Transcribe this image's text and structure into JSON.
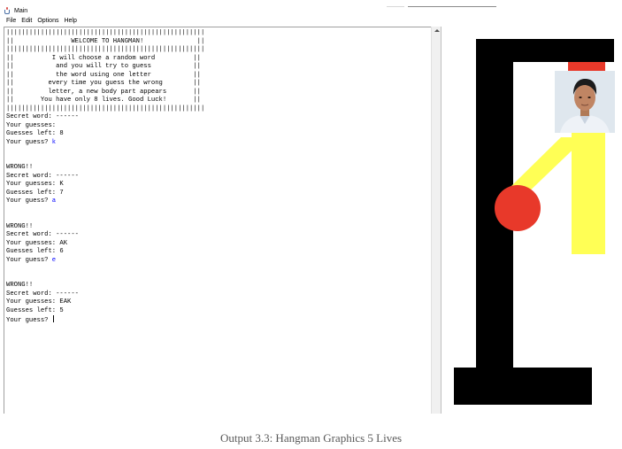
{
  "window": {
    "title": "Main"
  },
  "menu": {
    "items": [
      "File",
      "Edit",
      "Options",
      "Help"
    ]
  },
  "console": {
    "lines": [
      {
        "text": "||||||||||||||||||||||||||||||||||||||||||||||||||||"
      },
      {
        "text": "||               WELCOME TO HANGMAN!              ||"
      },
      {
        "text": "||||||||||||||||||||||||||||||||||||||||||||||||||||"
      },
      {
        "text": "||          I will choose a random word          ||"
      },
      {
        "text": "||           and you will try to guess           ||"
      },
      {
        "text": "||           the word using one letter           ||"
      },
      {
        "text": "||         every time you guess the wrong        ||"
      },
      {
        "text": "||         letter, a new body part appears       ||"
      },
      {
        "text": "||       You have only 8 lives. Good Luck!       ||"
      },
      {
        "text": "||||||||||||||||||||||||||||||||||||||||||||||||||||"
      },
      {
        "text": "Secret word: ------"
      },
      {
        "text": "Your guesses:"
      },
      {
        "text": "Guesses left: 8"
      },
      {
        "text": "Your guess? ",
        "input": "k"
      },
      {
        "text": ""
      },
      {
        "text": ""
      },
      {
        "text": "WRONG!!"
      },
      {
        "text": "Secret word: ------"
      },
      {
        "text": "Your guesses: K"
      },
      {
        "text": "Guesses left: 7"
      },
      {
        "text": "Your guess? ",
        "input": "a"
      },
      {
        "text": ""
      },
      {
        "text": ""
      },
      {
        "text": "WRONG!!"
      },
      {
        "text": "Secret word: ------"
      },
      {
        "text": "Your guesses: AK"
      },
      {
        "text": "Guesses left: 6"
      },
      {
        "text": "Your guess? ",
        "input": "e"
      },
      {
        "text": ""
      },
      {
        "text": ""
      },
      {
        "text": "WRONG!!"
      },
      {
        "text": "Secret word: ------"
      },
      {
        "text": "Your guesses: EAK"
      },
      {
        "text": "Guesses left: 5"
      },
      {
        "text": "Your guess? ",
        "cursor": true
      }
    ]
  },
  "graphics": {
    "colors": {
      "gallows": "#000000",
      "rope": "#e8392a",
      "head": "#e8392a",
      "body": "#ffff55",
      "photo_bg": "#dfe7ee"
    }
  },
  "caption": "Output 3.3: Hangman Graphics 5 Lives"
}
